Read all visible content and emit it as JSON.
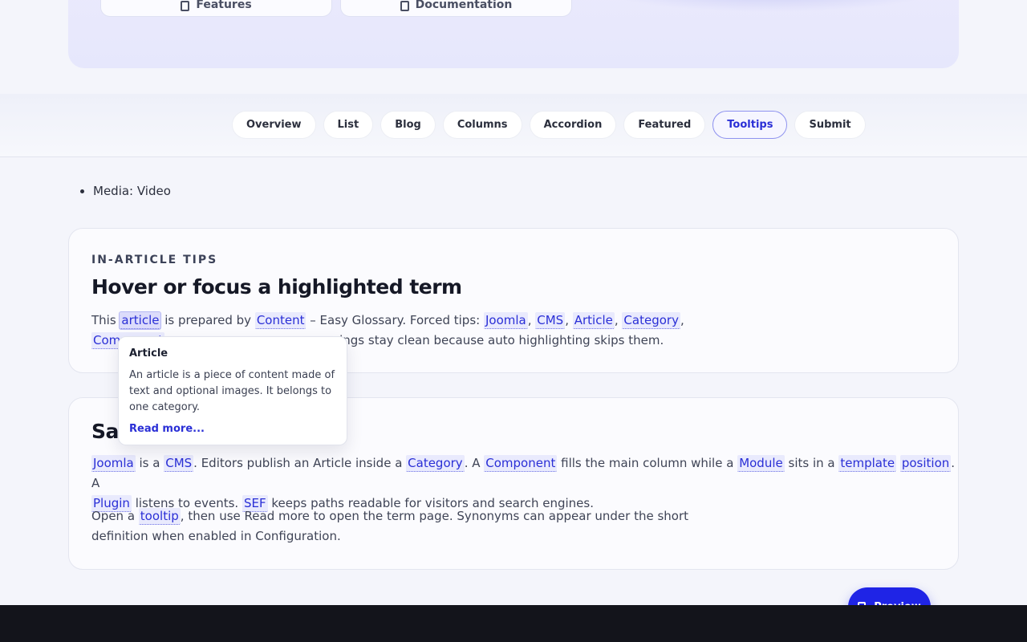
{
  "hero": {
    "card1_label": "Features",
    "card2_label": "Documentation"
  },
  "tabs": [
    {
      "label": "Overview"
    },
    {
      "label": "List"
    },
    {
      "label": "Blog"
    },
    {
      "label": "Columns"
    },
    {
      "label": "Accordion"
    },
    {
      "label": "Featured"
    },
    {
      "label": "Tooltips",
      "active": true
    },
    {
      "label": "Submit"
    }
  ],
  "bullet": "Media: Video",
  "card1": {
    "eyebrow": "IN-ARTICLE TIPS",
    "title": "Hover or focus a highlighted term",
    "p1_this": "This ",
    "p1_term_article": "article",
    "p1_prepared": " is prepared by ",
    "p1_term_content": "Content",
    "p1_glossary": " – Easy Glossary. Forced tips: ",
    "p1_term_joomla": "Joomla",
    "p1_term_cms": "CMS",
    "p1_term_article2": "Article",
    "p1_term_category": "Category",
    "p1_line2_term": "Component",
    "p1_tail": "ings stay clean because auto highlighting skips them."
  },
  "tooltip": {
    "title": "Article",
    "body": "An article is a piece of content made of text and optional images. It belongs to one category.",
    "link": "Read more..."
  },
  "card2": {
    "title_visible": "Sa",
    "p1": {
      "t1": "Joomla",
      "s1": " is a ",
      "t2": "CMS",
      "s2": ". Editors publish an Article inside a ",
      "t3": "Category",
      "s3": ". A ",
      "t4": "Component",
      "s4": " fills the main column while a ",
      "t5": "Module",
      "s5": " sits in a ",
      "t6": "template",
      "t7": "position",
      "s6": ". A",
      "t8": "Plugin",
      "s7": " listens to events. ",
      "t9": "SEF",
      "s8": " keeps paths readable for visitors and search engines."
    },
    "p2": {
      "s1": "Open a ",
      "t1": "tooltip",
      "s2": ", then use Read more to open the term page. Synonyms can appear under the short",
      "s3": "definition when enabled in Configuration."
    }
  },
  "preview_button": "Preview"
}
